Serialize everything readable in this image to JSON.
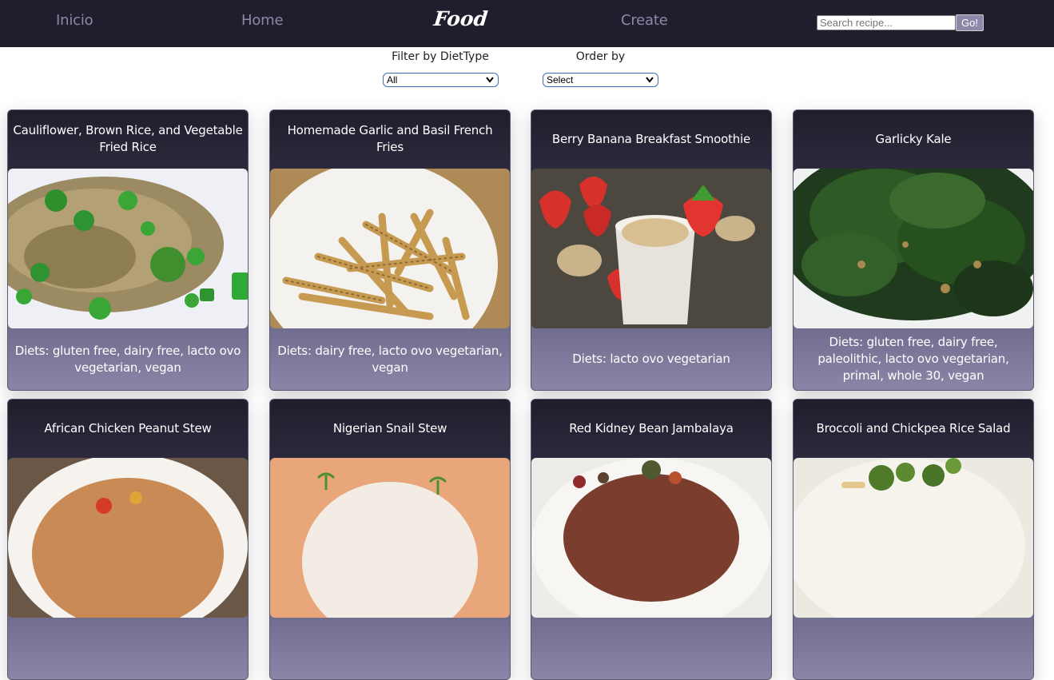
{
  "navbar": {
    "links": [
      "Inicio",
      "Home",
      "Create"
    ],
    "brand": "Food",
    "search_placeholder": "Search recipe...",
    "search_button": "Go!"
  },
  "filters": {
    "diet_label": "Filter by DietType",
    "diet_selected": "All",
    "order_label": "Order by",
    "order_selected": "Select"
  },
  "recipes": [
    {
      "title": "Cauliflower, Brown Rice, and Vegetable Fried Rice",
      "diets": "Diets: gluten free, dairy free, lacto ovo vegetarian, vegan",
      "image": "fried-rice-photo"
    },
    {
      "title": "Homemade Garlic and Basil French Fries",
      "diets": "Diets: dairy free, lacto ovo vegetarian, vegan",
      "image": "french-fries-photo"
    },
    {
      "title": "Berry Banana Breakfast Smoothie",
      "diets": "Diets: lacto ovo vegetarian",
      "image": "smoothie-photo"
    },
    {
      "title": "Garlicky Kale",
      "diets": "Diets: gluten free, dairy free, paleolithic, lacto ovo vegetarian, primal, whole 30, vegan",
      "image": "kale-photo"
    },
    {
      "title": "African Chicken Peanut Stew",
      "diets": "",
      "image": "peanut-stew-photo"
    },
    {
      "title": "Nigerian Snail Stew",
      "diets": "",
      "image": "snail-stew-photo"
    },
    {
      "title": "Red Kidney Bean Jambalaya",
      "diets": "",
      "image": "jambalaya-photo"
    },
    {
      "title": "Broccoli and Chickpea Rice Salad",
      "diets": "",
      "image": "rice-salad-photo"
    }
  ],
  "colors": {
    "navbar_bg": "#201d2c",
    "nav_link": "#8c88aa",
    "card_top": "#201d2c",
    "card_bottom": "#8a86a8"
  }
}
